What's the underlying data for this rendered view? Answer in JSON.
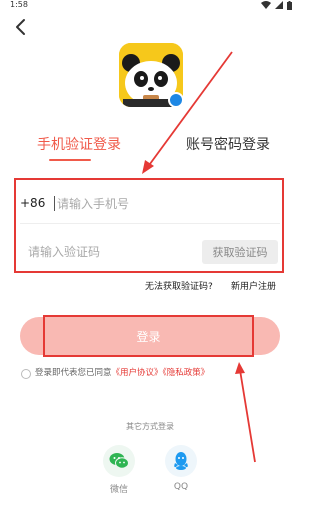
{
  "status_bar": {
    "time": "1:58"
  },
  "tabs": [
    {
      "label": "手机验证登录",
      "active": true
    },
    {
      "label": "账号密码登录",
      "active": false
    }
  ],
  "form": {
    "country_code": "+86",
    "phone_placeholder": "请输入手机号",
    "code_placeholder": "请输入验证码",
    "get_code_label": "获取验证码"
  },
  "links": {
    "no_code": "无法获取验证码?",
    "register": "新用户注册"
  },
  "login_button": "登录",
  "agreement": {
    "prefix": "登录即代表您已同意",
    "user_agreement": "《用户协议》",
    "privacy_policy": "《隐私政策》"
  },
  "other_login": {
    "title": "其它方式登录",
    "options": [
      {
        "label": "微信",
        "icon": "wechat-icon"
      },
      {
        "label": "QQ",
        "icon": "qq-icon"
      }
    ]
  },
  "colors": {
    "accent": "#f05a4a",
    "login_button": "#f9b9b3",
    "annotation": "#e53935"
  }
}
